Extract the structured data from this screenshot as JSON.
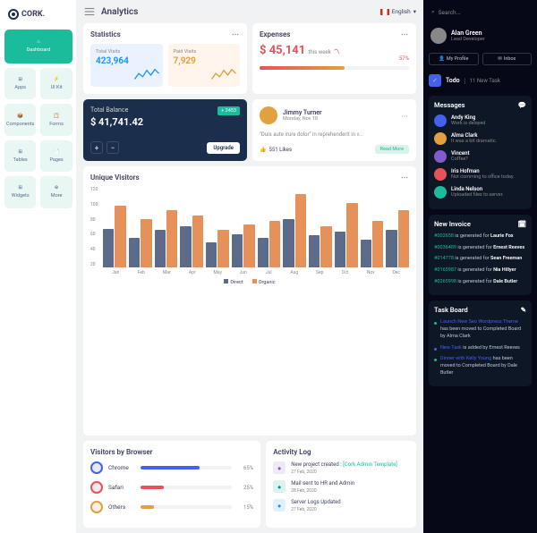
{
  "brand": "CORK.",
  "page_title": "Analytics",
  "lang": "English",
  "nav": [
    {
      "label": "Dashboard",
      "active": true
    },
    {
      "label": "Apps"
    },
    {
      "label": "UI Kit"
    },
    {
      "label": "Components"
    },
    {
      "label": "Forms"
    },
    {
      "label": "Tables"
    },
    {
      "label": "Pages"
    },
    {
      "label": "Widgets"
    },
    {
      "label": "More"
    }
  ],
  "stats_title": "Statistics",
  "stats": [
    {
      "label": "Total Visits",
      "value": "423,964",
      "color": "blue"
    },
    {
      "label": "Paid Visits",
      "value": "7,929",
      "color": "orange"
    }
  ],
  "expenses": {
    "title": "Expenses",
    "amount": "$ 45,141",
    "sub": "this week",
    "pct": "57%"
  },
  "balance": {
    "label": "Total Balance",
    "amount": "$ 41,741.42",
    "badge": "+ 2453",
    "upgrade": "Upgrade"
  },
  "post": {
    "name": "Jimmy Turner",
    "date": "Monday, Nov 18",
    "quote": "\"Duis aute irure dolor\" in reprehenderit in v...",
    "likes": "551 Likes",
    "readmore": "Read More"
  },
  "chart_data": {
    "type": "bar",
    "title": "Unique Visitors",
    "ylabel": "",
    "xlabel": "",
    "ylim": [
      0,
      120
    ],
    "y_ticks": [
      20,
      40,
      60,
      80,
      100,
      120
    ],
    "categories": [
      "Jan",
      "Feb",
      "Mar",
      "Apr",
      "May",
      "Jun",
      "Jul",
      "Aug",
      "Sep",
      "Oct",
      "Nov",
      "Dec"
    ],
    "series": [
      {
        "name": "Direct",
        "values": [
          58,
          44,
          56,
          62,
          38,
          50,
          44,
          72,
          48,
          54,
          42,
          56
        ]
      },
      {
        "name": "Organic",
        "values": [
          92,
          72,
          86,
          78,
          56,
          64,
          70,
          110,
          62,
          96,
          70,
          86
        ]
      }
    ]
  },
  "browsers": {
    "title": "Visitors by Browser",
    "items": [
      {
        "name": "Chrome",
        "pct": 65,
        "color": "#4361ee"
      },
      {
        "name": "Safari",
        "pct": 25,
        "color": "#e7515a"
      },
      {
        "name": "Others",
        "pct": 15,
        "color": "#e2a03f"
      }
    ]
  },
  "activity": {
    "title": "Activity Log",
    "items": [
      {
        "text": "New project created :",
        "link": "[Cork Admin Template]",
        "date": "27 Feb, 2020",
        "color": "#805dca"
      },
      {
        "text": "Mail sent to HR and Admin",
        "link": "",
        "date": "28 Feb, 2020",
        "color": "#009688"
      },
      {
        "text": "Server Logs Updated",
        "link": "",
        "date": "27 Feb, 2020",
        "color": "#2196f3"
      }
    ]
  },
  "search_placeholder": "Search...",
  "user": {
    "name": "Alan Green",
    "role": "Lead Developer"
  },
  "user_btns": [
    "My Profile",
    "Inbox"
  ],
  "todo": {
    "label": "Todo",
    "count": "11 New Task"
  },
  "messages": {
    "title": "Messages",
    "items": [
      {
        "name": "Andy King",
        "text": "Work is delayed",
        "color": "#4361ee"
      },
      {
        "name": "Alma Clark",
        "text": "It was a bit dramatic.",
        "color": "#e2a03f"
      },
      {
        "name": "Vincent",
        "text": "Coffee?",
        "color": "#805dca"
      },
      {
        "name": "Iris Hofman",
        "text": "Not comming to office today.",
        "color": "#e7515a"
      },
      {
        "name": "Linda Nelson",
        "text": "Uploaded files to server.",
        "color": "#1abc9c"
      }
    ]
  },
  "invoices": {
    "title": "New Invoice",
    "items": [
      {
        "id": "#002658",
        "name": "Laurie Fox"
      },
      {
        "id": "#0036489",
        "name": "Ernest Reeves"
      },
      {
        "id": "#014778",
        "name": "Sean Freeman"
      },
      {
        "id": "#0165987",
        "name": "Nia Hillyer"
      },
      {
        "id": "#0265998",
        "name": "Dale Butler"
      }
    ],
    "verb": "is generated for"
  },
  "taskboard": {
    "title": "Task Board",
    "items": [
      {
        "link": "Launch New Seo Wordpress Theme",
        "rest": " has been moved to Completed Board by Alma Clark",
        "color": "#1abc9c"
      },
      {
        "link": "New Task",
        "rest": " is added by Ernest Reeves",
        "color": "#4361ee"
      },
      {
        "link": "Dinner with Kelly Young",
        "rest": " has been moved to Completed Board by Dale Butler",
        "color": "#1abc9c"
      }
    ]
  }
}
